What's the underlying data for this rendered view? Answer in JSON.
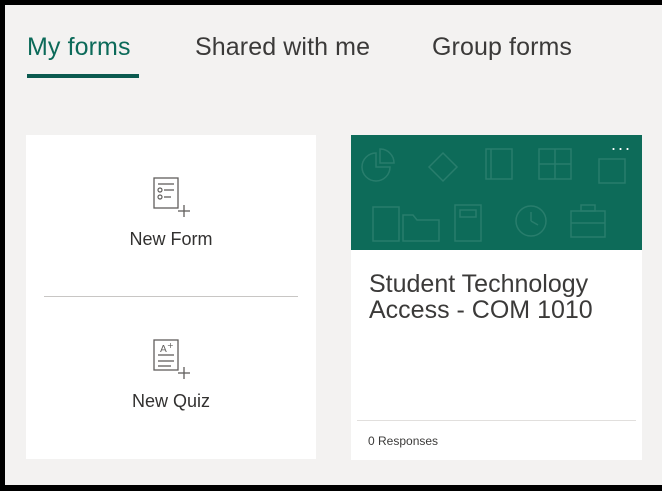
{
  "tabs": [
    {
      "label": "My forms",
      "active": true
    },
    {
      "label": "Shared with me",
      "active": false
    },
    {
      "label": "Group forms",
      "active": false
    }
  ],
  "create": {
    "new_form_label": "New Form",
    "new_quiz_label": "New Quiz",
    "new_form_icon": "form-plus-icon",
    "new_quiz_icon": "quiz-plus-icon"
  },
  "forms": [
    {
      "title": "Student Technology Access - COM 1010",
      "responses": "0 Responses",
      "more_label": "···",
      "banner_color": "#0d6b59"
    }
  ],
  "colors": {
    "accent": "#0b5a4f",
    "background": "#f3f2f1",
    "card": "#ffffff"
  }
}
